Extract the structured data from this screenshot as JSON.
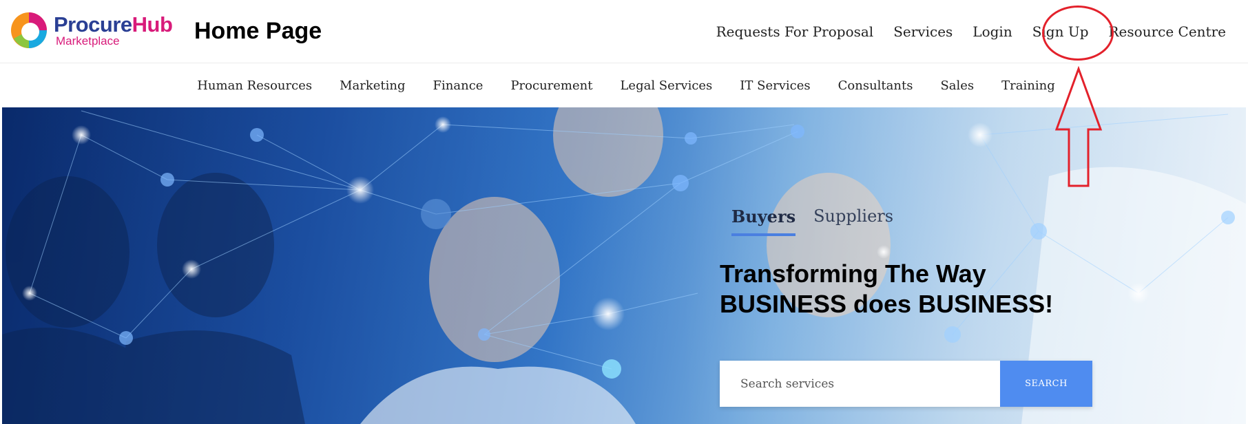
{
  "brand": {
    "name_part1": "Procure",
    "name_part2": "Hub",
    "subtitle": "Marketplace",
    "colors": {
      "navy": "#2a3f94",
      "magenta": "#d81b7a",
      "orange": "#f7941d",
      "cyan": "#19a9e0",
      "green": "#8cc63f"
    }
  },
  "page_heading": "Home Page",
  "top_nav": [
    {
      "label": "Requests For Proposal"
    },
    {
      "label": "Services"
    },
    {
      "label": "Login"
    },
    {
      "label": "Sign Up"
    },
    {
      "label": "Resource Centre"
    }
  ],
  "category_nav": [
    {
      "label": "Human Resources"
    },
    {
      "label": "Marketing"
    },
    {
      "label": "Finance"
    },
    {
      "label": "Procurement"
    },
    {
      "label": "Legal Services"
    },
    {
      "label": "IT Services"
    },
    {
      "label": "Consultants"
    },
    {
      "label": "Sales"
    },
    {
      "label": "Training"
    }
  ],
  "hero": {
    "tabs": [
      {
        "label": "Buyers",
        "active": true
      },
      {
        "label": "Suppliers",
        "active": false
      }
    ],
    "headline_line1": "Transforming The Way",
    "headline_line2": "BUSINESS does BUSINESS!",
    "search": {
      "placeholder": "Search services",
      "value": "",
      "button_label": "SEARCH",
      "button_color": "#4f8cf0"
    }
  },
  "annotation": {
    "highlight_color": "#e3212b",
    "highlight_target": "Sign Up"
  }
}
